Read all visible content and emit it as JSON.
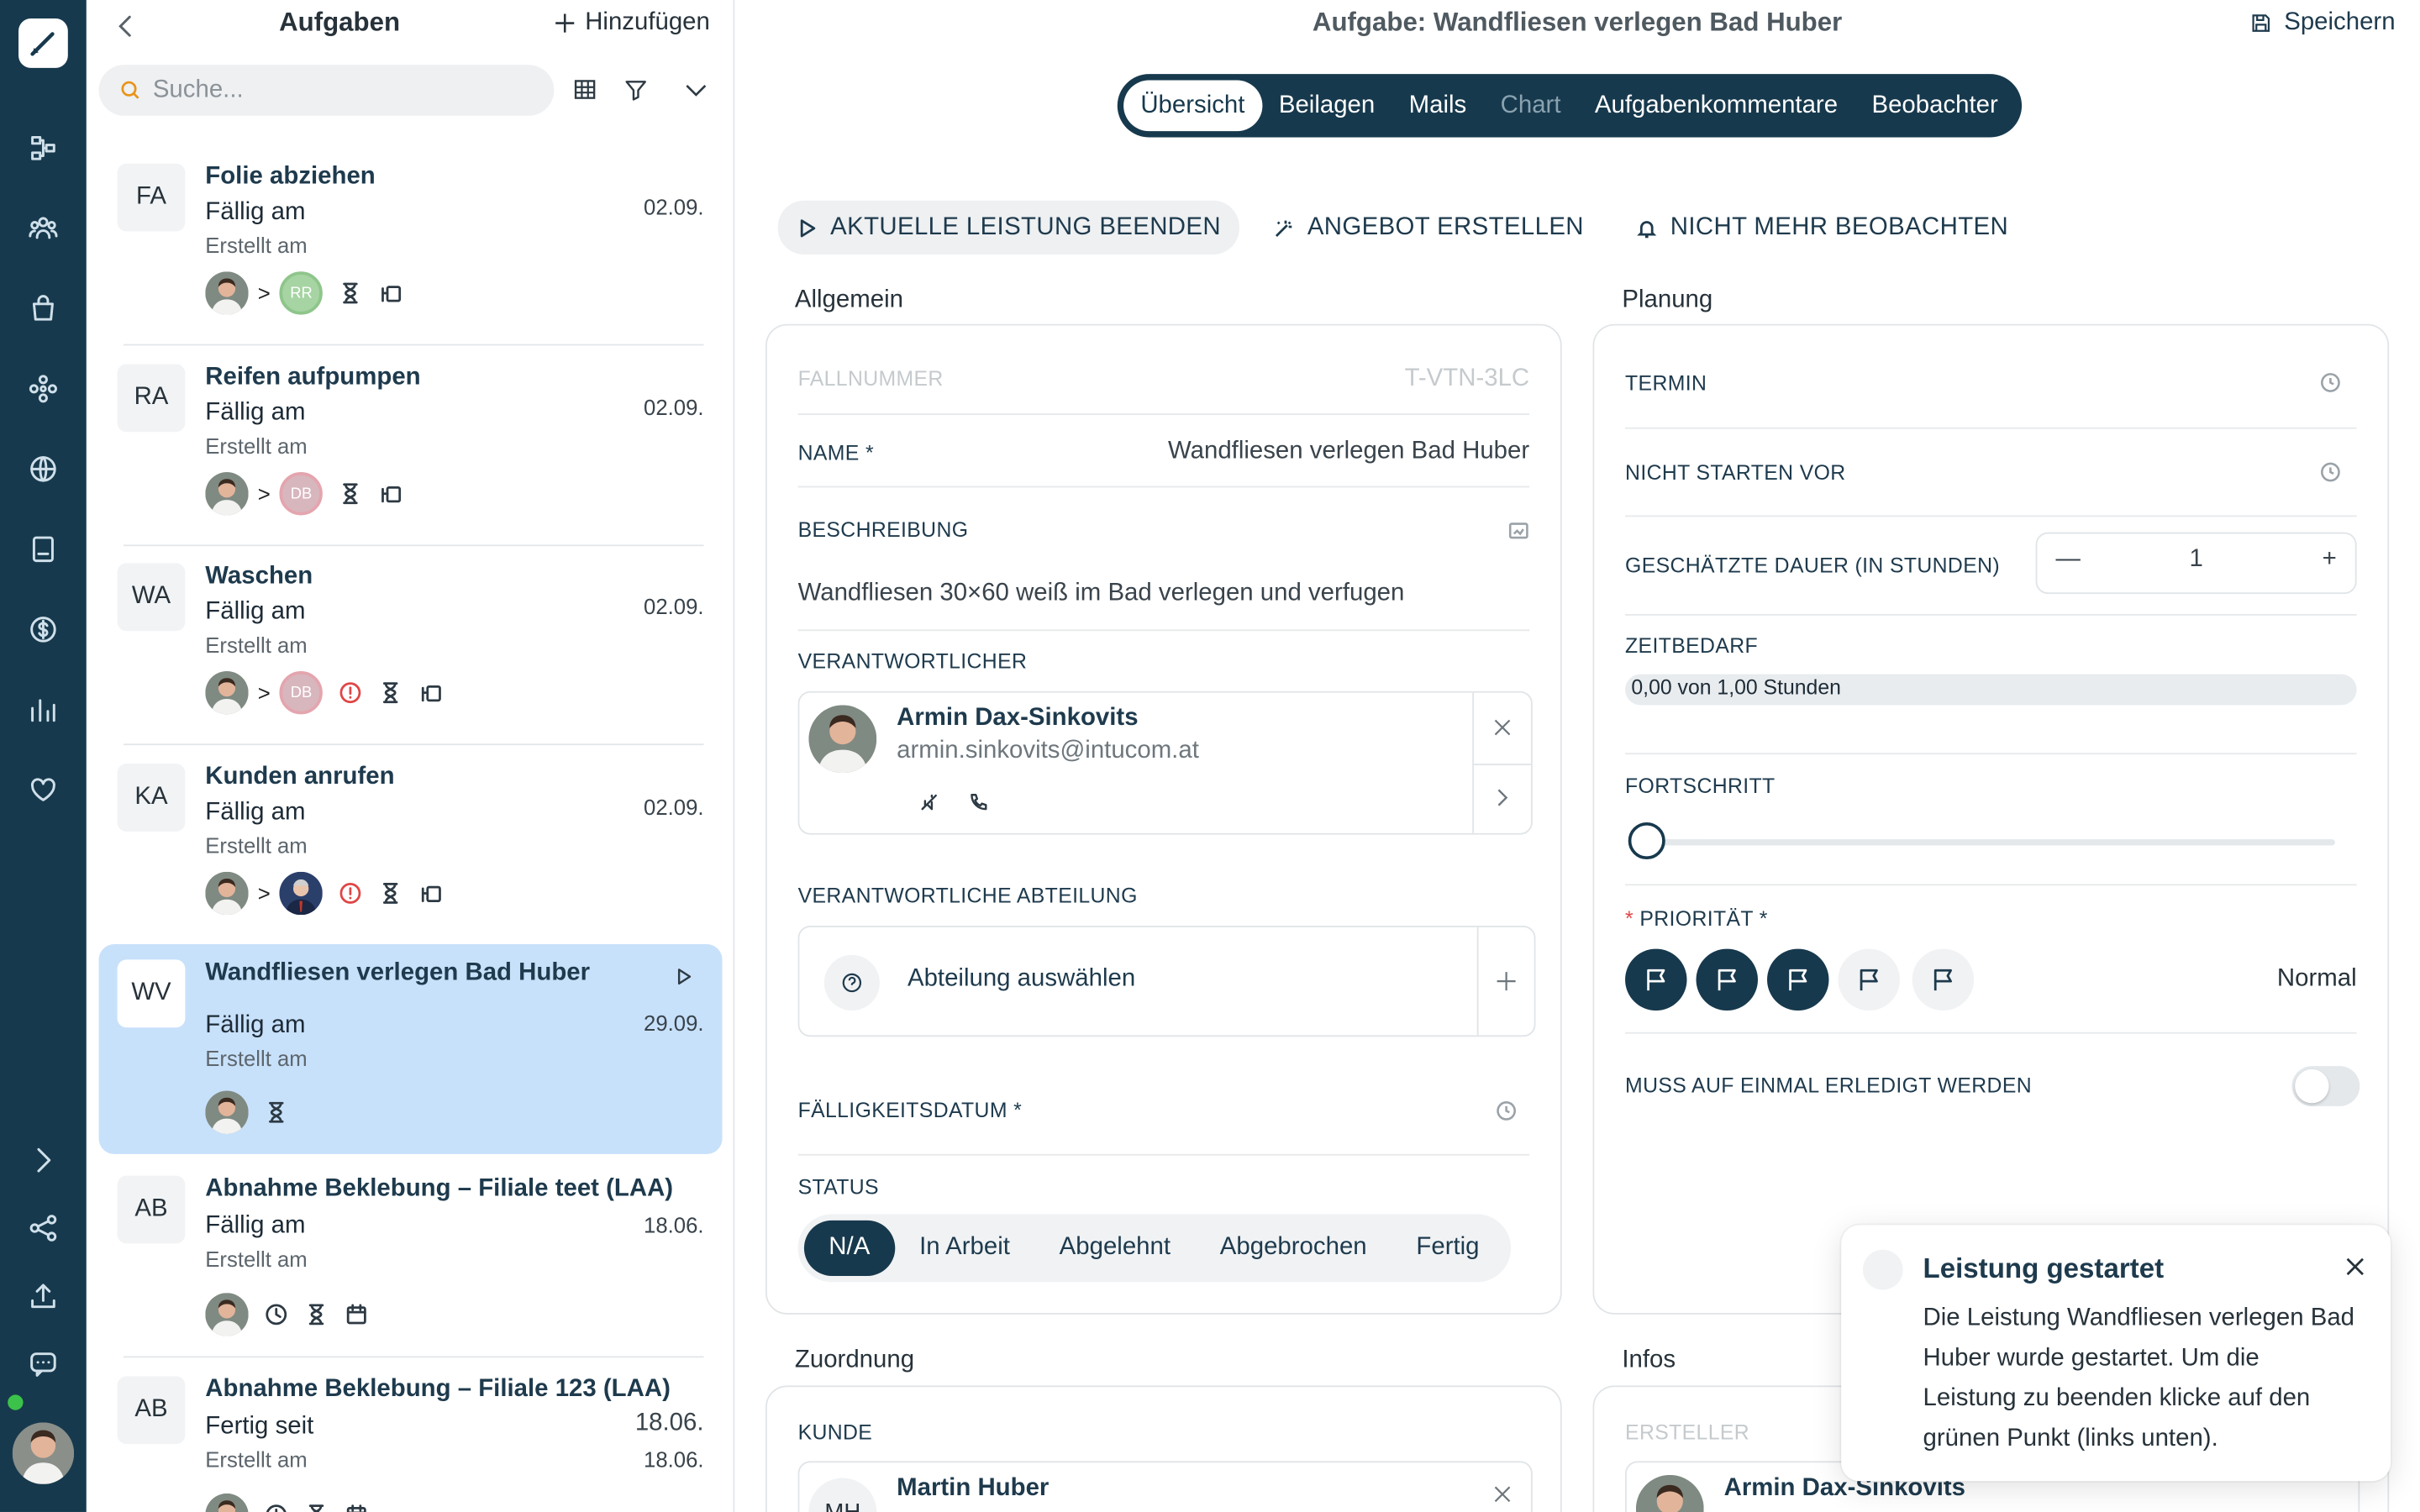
{
  "list": {
    "title": "Aufgaben",
    "add_label": "Hinzufügen",
    "search_placeholder": "Suche...",
    "tasks": [
      {
        "initials": "FA",
        "title": "Folie abziehen",
        "due_label": "Fällig am",
        "created_label": "Erstellt am",
        "date": "02.09.",
        "assignee_initials": "RR"
      },
      {
        "initials": "RA",
        "title": "Reifen aufpumpen",
        "due_label": "Fällig am",
        "created_label": "Erstellt am",
        "date": "02.09.",
        "assignee_initials": "DB"
      },
      {
        "initials": "WA",
        "title": "Waschen",
        "due_label": "Fällig am",
        "created_label": "Erstellt am",
        "date": "02.09.",
        "assignee_initials": "DB"
      },
      {
        "initials": "KA",
        "title": "Kunden anrufen",
        "due_label": "Fällig am",
        "created_label": "Erstellt am",
        "date": "02.09."
      },
      {
        "initials": "WV",
        "title": "Wandfliesen verlegen Bad Huber",
        "due_label": "Fällig am",
        "created_label": "Erstellt am",
        "date": "29.09.",
        "selected": true
      },
      {
        "initials": "AB",
        "title": "Abnahme Beklebung – Filiale teet (LAA)",
        "due_label": "Fällig am",
        "created_label": "Erstellt am",
        "date": "18.06."
      },
      {
        "initials": "AB",
        "title": "Abnahme Beklebung – Filiale 123 (LAA)",
        "due_label": "Fertig seit",
        "created_label": "Erstellt am",
        "date": "18.06.",
        "date2": "18.06."
      }
    ]
  },
  "header": {
    "title": "Aufgabe: Wandfliesen verlegen Bad Huber",
    "save_label": "Speichern"
  },
  "tabs": [
    "Übersicht",
    "Beilagen",
    "Mails",
    "Chart",
    "Aufgabenkommentare",
    "Beobachter"
  ],
  "actions": {
    "end_service": "AKTUELLE LEISTUNG BEENDEN",
    "create_offer": "ANGEBOT ERSTELLEN",
    "unwatch": "NICHT MEHR BEOBACHTEN"
  },
  "general": {
    "section_title": "Allgemein",
    "case_number_label": "FALLNUMMER",
    "case_number": "T-VTN-3LC",
    "name_label": "NAME *",
    "name": "Wandfliesen verlegen Bad Huber",
    "description_label": "BESCHREIBUNG",
    "description": "Wandfliesen 30×60 weiß im Bad verlegen und verfugen",
    "responsible_label": "VERANTWORTLICHER",
    "responsible_name": "Armin Dax-Sinkovits",
    "responsible_email": "armin.sinkovits@intucom.at",
    "department_label": "VERANTWORTLICHE ABTEILUNG",
    "department_placeholder": "Abteilung auswählen",
    "due_date_label": "FÄLLIGKEITSDATUM *",
    "status_label": "STATUS",
    "status_options": [
      "N/A",
      "In Arbeit",
      "Abgelehnt",
      "Abgebrochen",
      "Fertig"
    ],
    "status_selected": "N/A"
  },
  "planning": {
    "section_title": "Planung",
    "appointment_label": "TERMIN",
    "not_before_label": "NICHT STARTEN VOR",
    "duration_label": "GESCHÄTZTE DAUER (IN STUNDEN)",
    "duration_value": "1",
    "time_needed_label": "ZEITBEDARF",
    "time_needed_value": "0,00 von 1,00 Stunden",
    "time_needed_fraction": 0.0,
    "progress_label": "FORTSCHRITT",
    "progress_value": 0,
    "priority_prefix": "*",
    "priority_label": "PRIORITÄT *",
    "priority_value": "Normal",
    "priority_level": 3,
    "priority_max": 5,
    "once_label": "MUSS AUF EINMAL ERLEDIGT WERDEN",
    "once_on": false
  },
  "assignment": {
    "section_title": "Zuordnung",
    "customer_label": "KUNDE",
    "customer_initials": "MH",
    "customer_name": "Martin Huber"
  },
  "infos": {
    "section_title": "Infos",
    "creator_label": "ERSTELLER",
    "creator_name": "Armin Dax-Sinkovits"
  },
  "toast": {
    "title": "Leistung gestartet",
    "body": "Die Leistung Wandfliesen verlegen Bad Huber wurde gestartet. Um die Leistung zu beenden klicke auf den grünen Punkt (links unten)."
  },
  "colors": {
    "primary": "#17394d",
    "selected_row": "#c8e1fb",
    "online_dot": "#3cc24a",
    "alert": "#e04646"
  }
}
